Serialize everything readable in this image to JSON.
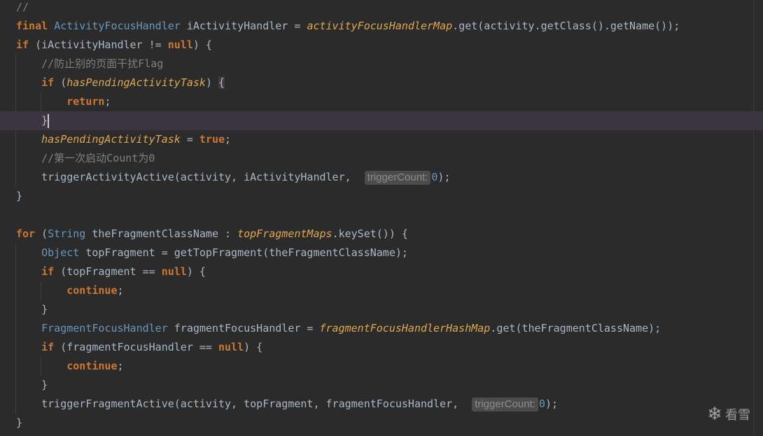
{
  "editor": {
    "lines": [
      [
        {
          "t": "//",
          "c": "comment"
        }
      ],
      [
        {
          "t": "final ",
          "c": "kw"
        },
        {
          "t": "ActivityFocusHandler",
          "c": "type"
        },
        {
          "t": " iActivityHandler = ",
          "c": "plain"
        },
        {
          "t": "activityFocusHandlerMap",
          "c": "ital"
        },
        {
          "t": ".get(activity.getClass().getName());",
          "c": "plain"
        }
      ],
      [
        {
          "t": "if ",
          "c": "kw"
        },
        {
          "t": "(iActivityHandler != ",
          "c": "plain"
        },
        {
          "t": "null",
          "c": "kw"
        },
        {
          "t": ") {",
          "c": "plain"
        }
      ],
      [
        {
          "t": "    //防止别的页面干扰Flag",
          "c": "comment"
        }
      ],
      [
        {
          "t": "    if ",
          "c": "kw"
        },
        {
          "t": "(",
          "c": "plain"
        },
        {
          "t": "hasPendingActivityTask",
          "c": "ital"
        },
        {
          "t": ") ",
          "c": "plain"
        },
        {
          "t": "{",
          "c": "bracehl"
        }
      ],
      [
        {
          "t": "        return",
          "c": "kw"
        },
        {
          "t": ";",
          "c": "plain"
        }
      ],
      [
        {
          "t": "    ",
          "c": "plain"
        },
        {
          "t": "}",
          "c": "bracehl"
        }
      ],
      [
        {
          "t": "    ",
          "c": "plain"
        },
        {
          "t": "hasPendingActivityTask",
          "c": "ital"
        },
        {
          "t": " = ",
          "c": "plain"
        },
        {
          "t": "true",
          "c": "kw"
        },
        {
          "t": ";",
          "c": "plain"
        }
      ],
      [
        {
          "t": "    //第一次启动Count为0",
          "c": "comment"
        }
      ],
      [
        {
          "t": "    triggerActivityActive(activity, iActivityHandler, ",
          "c": "plain"
        },
        {
          "t": "triggerCount:",
          "c": "hint"
        },
        {
          "t": "0",
          "c": "num"
        },
        {
          "t": ");",
          "c": "plain"
        }
      ],
      [
        {
          "t": "}",
          "c": "plain"
        }
      ],
      [],
      [
        {
          "t": "for ",
          "c": "kw"
        },
        {
          "t": "(",
          "c": "plain"
        },
        {
          "t": "String",
          "c": "type"
        },
        {
          "t": " theFragmentClassName : ",
          "c": "plain"
        },
        {
          "t": "topFragmentMaps",
          "c": "ital"
        },
        {
          "t": ".keySet()) {",
          "c": "plain"
        }
      ],
      [
        {
          "t": "    ",
          "c": "plain"
        },
        {
          "t": "Object",
          "c": "type"
        },
        {
          "t": " topFragment = getTopFragment(theFragmentClassName);",
          "c": "plain"
        }
      ],
      [
        {
          "t": "    if ",
          "c": "kw"
        },
        {
          "t": "(topFragment == ",
          "c": "plain"
        },
        {
          "t": "null",
          "c": "kw"
        },
        {
          "t": ") {",
          "c": "plain"
        }
      ],
      [
        {
          "t": "        continue",
          "c": "kw"
        },
        {
          "t": ";",
          "c": "plain"
        }
      ],
      [
        {
          "t": "    }",
          "c": "plain"
        }
      ],
      [
        {
          "t": "    ",
          "c": "plain"
        },
        {
          "t": "FragmentFocusHandler",
          "c": "type"
        },
        {
          "t": " fragmentFocusHandler = ",
          "c": "plain"
        },
        {
          "t": "fragmentFocusHandlerHashMap",
          "c": "ital"
        },
        {
          "t": ".get(theFragmentClassName);",
          "c": "plain"
        }
      ],
      [
        {
          "t": "    if ",
          "c": "kw"
        },
        {
          "t": "(fragmentFocusHandler == ",
          "c": "plain"
        },
        {
          "t": "null",
          "c": "kw"
        },
        {
          "t": ") {",
          "c": "plain"
        }
      ],
      [
        {
          "t": "        continue",
          "c": "kw"
        },
        {
          "t": ";",
          "c": "plain"
        }
      ],
      [
        {
          "t": "    }",
          "c": "plain"
        }
      ],
      [
        {
          "t": "    triggerFragmentActive(activity, topFragment, fragmentFocusHandler, ",
          "c": "plain"
        },
        {
          "t": "triggerCount:",
          "c": "hint"
        },
        {
          "t": "0",
          "c": "num"
        },
        {
          "t": ");",
          "c": "plain"
        }
      ],
      [
        {
          "t": "}",
          "c": "plain"
        }
      ]
    ],
    "current_line_index": 6
  },
  "watermark": {
    "icon": "snowflake-icon",
    "text": "看雪"
  }
}
